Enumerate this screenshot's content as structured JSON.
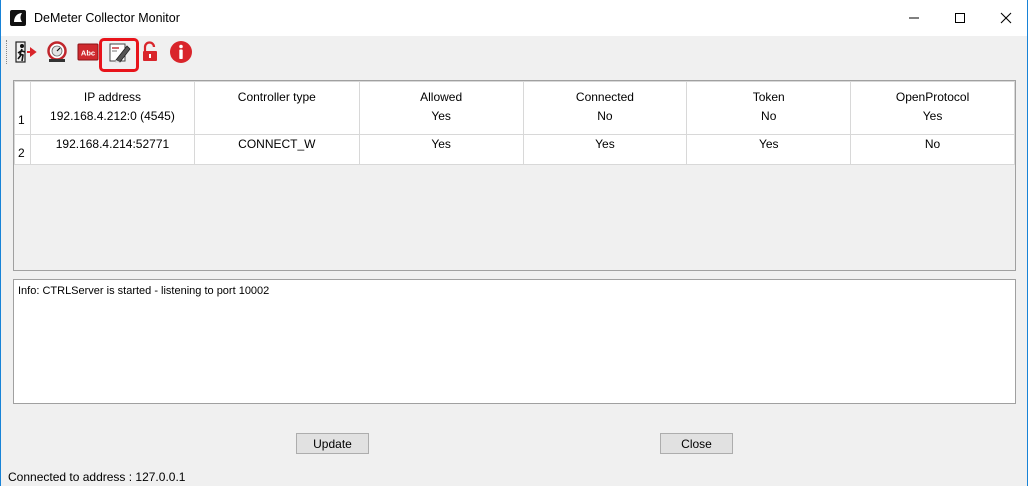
{
  "window": {
    "title": "DeMeter Collector Monitor"
  },
  "toolbar": {
    "icons": [
      "exit-icon",
      "gauge-icon",
      "text-abc-icon",
      "certificate-edit-icon",
      "unlock-icon",
      "info-icon"
    ]
  },
  "grid": {
    "columns": [
      "IP address",
      "Controller type",
      "Allowed",
      "Connected",
      "Token",
      "OpenProtocol"
    ],
    "rows": [
      {
        "index": "1",
        "ip": "192.168.4.212:0  (4545)",
        "controller_type": "",
        "allowed": "Yes",
        "connected": "No",
        "token": "No",
        "open_protocol": "Yes"
      },
      {
        "index": "2",
        "ip": "192.168.4.214:52771",
        "controller_type": "CONNECT_W",
        "allowed": "Yes",
        "connected": "Yes",
        "token": "Yes",
        "open_protocol": "No"
      }
    ]
  },
  "log": {
    "text": "Info: CTRLServer is started - listening to port 10002"
  },
  "buttons": {
    "update": "Update",
    "close": "Close"
  },
  "status": {
    "text": "Connected to address : 127.0.0.1"
  },
  "colors": {
    "highlight": "#e8141b",
    "accent_red": "#d9252b",
    "border": "#1883d7"
  }
}
